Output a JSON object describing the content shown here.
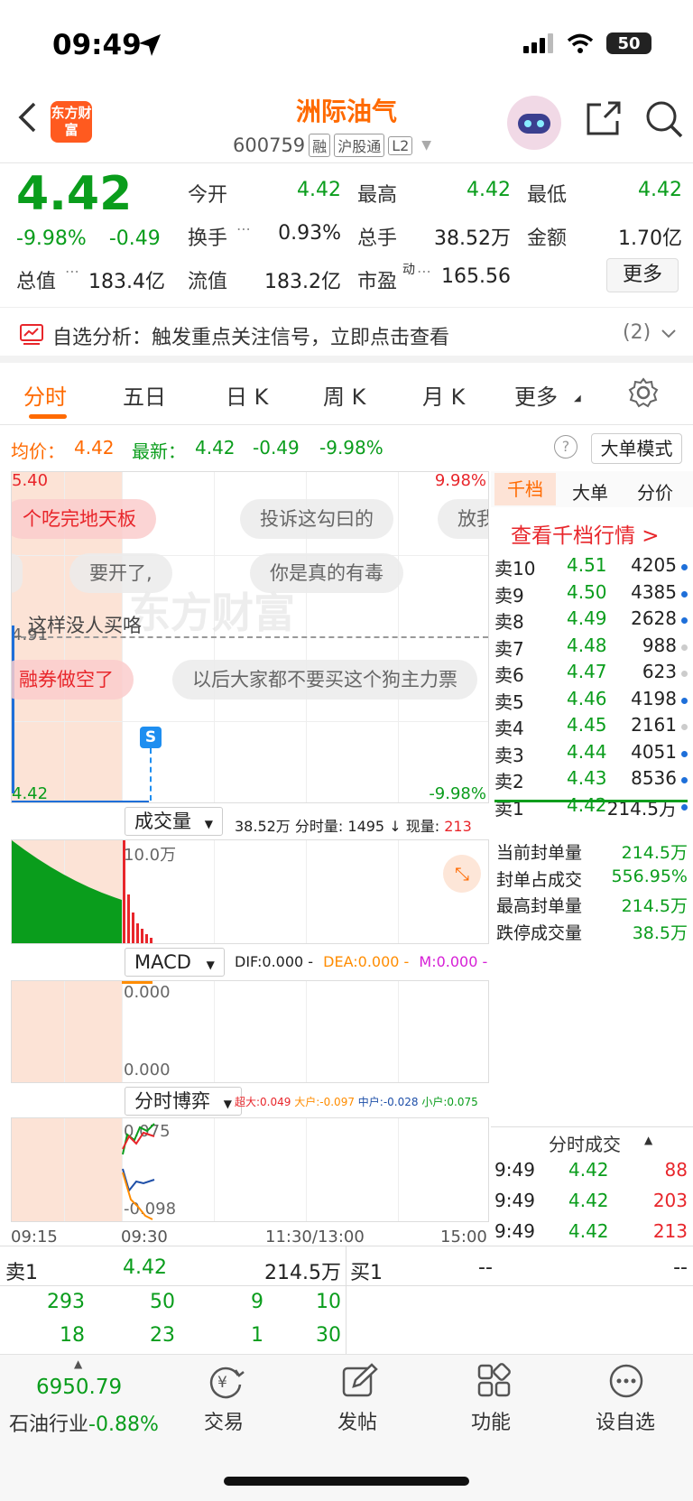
{
  "status_bar": {
    "time": "09:49",
    "battery": "50"
  },
  "nav": {
    "title": "洲际油气",
    "code": "600759",
    "tags": [
      "融",
      "沪股通",
      "L2"
    ],
    "logo_text": "东方财富"
  },
  "quote": {
    "price": "4.42",
    "change_pct": "-9.98%",
    "change": "-0.49",
    "fields": {
      "open_label": "今开",
      "open": "4.42",
      "high_label": "最高",
      "high": "4.42",
      "low_label": "最低",
      "low": "4.42",
      "turnover_label": "换手",
      "turnover": "0.93%",
      "volume_label": "总手",
      "volume": "38.52万",
      "amount_label": "金额",
      "amount": "1.70亿",
      "mktcap_label": "总值",
      "mktcap": "183.4亿",
      "float_label": "流值",
      "float": "183.2亿",
      "pe_label": "市盈",
      "pe_sup": "动",
      "pe": "165.56"
    },
    "more_label": "更多"
  },
  "signal": {
    "text": "自选分析：触发重点关注信号，立即点击查看",
    "count": "(2)"
  },
  "tabs": [
    "分时",
    "五日",
    "日 K",
    "周 K",
    "月 K",
    "更多"
  ],
  "avg_row": {
    "avg_label": "均价：",
    "avg": "4.42",
    "latest_label": "最新：",
    "latest": "4.42",
    "chg": "-0.49",
    "pct": "-9.98%",
    "mode_label": "大单模式"
  },
  "chart": {
    "price_top": "5.40",
    "pct_top": "9.98%",
    "price_mid": "4.91",
    "price_bottom": "4.42",
    "pct_bottom": "-9.98%",
    "watermark": "东方财富",
    "s_marker": "S",
    "bubbles": [
      "个吃完地天板",
      "投诉这勾曰的",
      "放我",
      "要开了,",
      "你是真的有毒",
      "这样没人买咯",
      "融券做空了",
      "以后大家都不要买这个狗主力票"
    ],
    "volume": {
      "btn": "成交量",
      "total": "38.52万",
      "minute": "分时量: 1495",
      "now_label": "现量:",
      "now": "213",
      "max": "10.0万"
    },
    "macd": {
      "btn": "MACD",
      "dif": "DIF:0.000",
      "dea": "DEA:0.000",
      "m": "M:0.000",
      "top": "0.000",
      "bottom": "0.000"
    },
    "game": {
      "btn": "分时博弈",
      "super": "超大:0.049",
      "big": "大户:-0.097",
      "mid": "中户:-0.028",
      "small": "小户:0.075",
      "top": "0.075",
      "bottom": "-0.098"
    },
    "time_axis": [
      "09:15",
      "09:30",
      "11:30/13:00",
      "15:00"
    ]
  },
  "orderbook": {
    "tabs": [
      "千档",
      "大单",
      "分价"
    ],
    "link": "查看千档行情 >",
    "rows": [
      {
        "label": "卖10",
        "price": "4.51",
        "vol": "4205",
        "dot": "#1e6fd9"
      },
      {
        "label": "卖9",
        "price": "4.50",
        "vol": "4385",
        "dot": "#1e6fd9"
      },
      {
        "label": "卖8",
        "price": "4.49",
        "vol": "2628",
        "dot": "#1e6fd9"
      },
      {
        "label": "卖7",
        "price": "4.48",
        "vol": "988",
        "dot": "#cccccc"
      },
      {
        "label": "卖6",
        "price": "4.47",
        "vol": "623",
        "dot": "#cccccc"
      },
      {
        "label": "卖5",
        "price": "4.46",
        "vol": "4198",
        "dot": "#1e6fd9"
      },
      {
        "label": "卖4",
        "price": "4.45",
        "vol": "2161",
        "dot": "#cccccc"
      },
      {
        "label": "卖3",
        "price": "4.44",
        "vol": "4051",
        "dot": "#1e6fd9"
      },
      {
        "label": "卖2",
        "price": "4.43",
        "vol": "8536",
        "dot": "#1e6fd9"
      },
      {
        "label": "卖1",
        "price": "4.42",
        "vol": "214.5万",
        "dot": "#1e6fd9"
      }
    ],
    "stats": [
      {
        "label": "当前封单量",
        "value": "214.5万"
      },
      {
        "label": "封单占成交",
        "value": "556.95%"
      },
      {
        "label": "最高封单量",
        "value": "214.5万"
      },
      {
        "label": "跌停成交量",
        "value": "38.5万"
      }
    ],
    "trades_title": "分时成交",
    "trades": [
      {
        "time": "9:49",
        "price": "4.42",
        "vol": "88"
      },
      {
        "time": "9:49",
        "price": "4.42",
        "vol": "203"
      },
      {
        "time": "9:49",
        "price": "4.42",
        "vol": "213"
      }
    ]
  },
  "bottom_quotes": {
    "sell_label": "卖1",
    "sell_price": "4.42",
    "sell_vol": "214.5万",
    "buy_label": "买1",
    "buy_price": "--",
    "buy_vol": "--",
    "grid": [
      [
        "293",
        "50",
        "9",
        "10"
      ],
      [
        "18",
        "23",
        "1",
        "30"
      ]
    ]
  },
  "bottom_bar": {
    "index_value": "6950.79",
    "index_label": "石油行业",
    "index_chg": "-0.88%",
    "items": [
      "交易",
      "发帖",
      "功能",
      "设自选"
    ]
  }
}
